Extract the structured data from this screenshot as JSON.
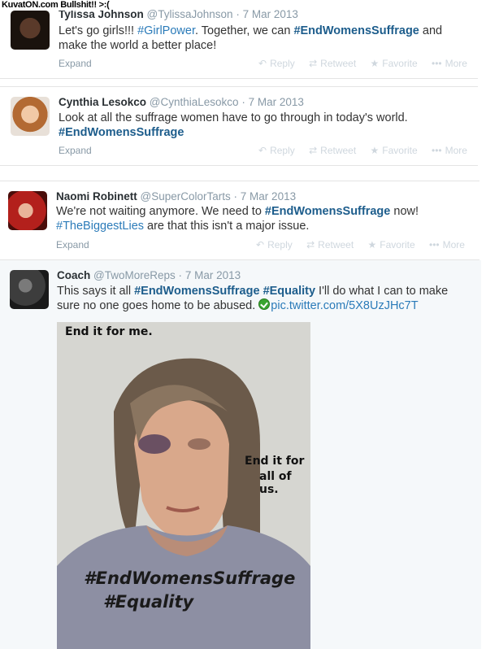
{
  "watermark": "KuvatON.com Bullshit!! >:(",
  "actions": {
    "reply": "Reply",
    "retweet": "Retweet",
    "favorite": "Favorite",
    "more": "More",
    "expand": "Expand"
  },
  "tweets": [
    {
      "name": "Tylissa Johnson",
      "handle": "@TylissaJohnson",
      "sep": "·",
      "date": "7 Mar 2013",
      "parts": [
        "Let's go girls!!! ",
        "#GirlPower",
        ". Together, we can ",
        "#EndWomensSuffrage",
        " and make the world a better place!"
      ]
    },
    {
      "name": "Cynthia Lesokco",
      "handle": "@CynthiaLesokco",
      "sep": "·",
      "date": "7 Mar 2013",
      "parts": [
        "Look at all the suffrage women have to go through in today's world. ",
        "#EndWomensSuffrage"
      ]
    },
    {
      "name": "Naomi Robinett",
      "handle": "@SuperColorTarts",
      "sep": "·",
      "date": "7 Mar 2013",
      "parts": [
        "We're not waiting anymore. We need to ",
        "#EndWomensSuffrage",
        " now! ",
        "#TheBiggestLies",
        " are that this isn't a major issue."
      ]
    },
    {
      "name": "Coach",
      "handle": "@TwoMoreReps",
      "sep": "·",
      "date": "7 Mar 2013",
      "parts": [
        "This says it all ",
        "#EndWomensSuffrage",
        " ",
        "#Equality",
        " I'll do what I can to make sure no one goes home to be abused. ",
        "pic.twitter.com/5X8UzJHc7T"
      ]
    }
  ],
  "photo": {
    "top_text": "End it for me.",
    "side_text_1": "End it for",
    "side_text_2": "all of us.",
    "hashtag_1": "#EndWomensSuffrage",
    "hashtag_2": "#Equality"
  },
  "colors": {
    "link": "#2b7bb9",
    "muted": "#8899a6",
    "action_icons": "#cfd7de"
  }
}
